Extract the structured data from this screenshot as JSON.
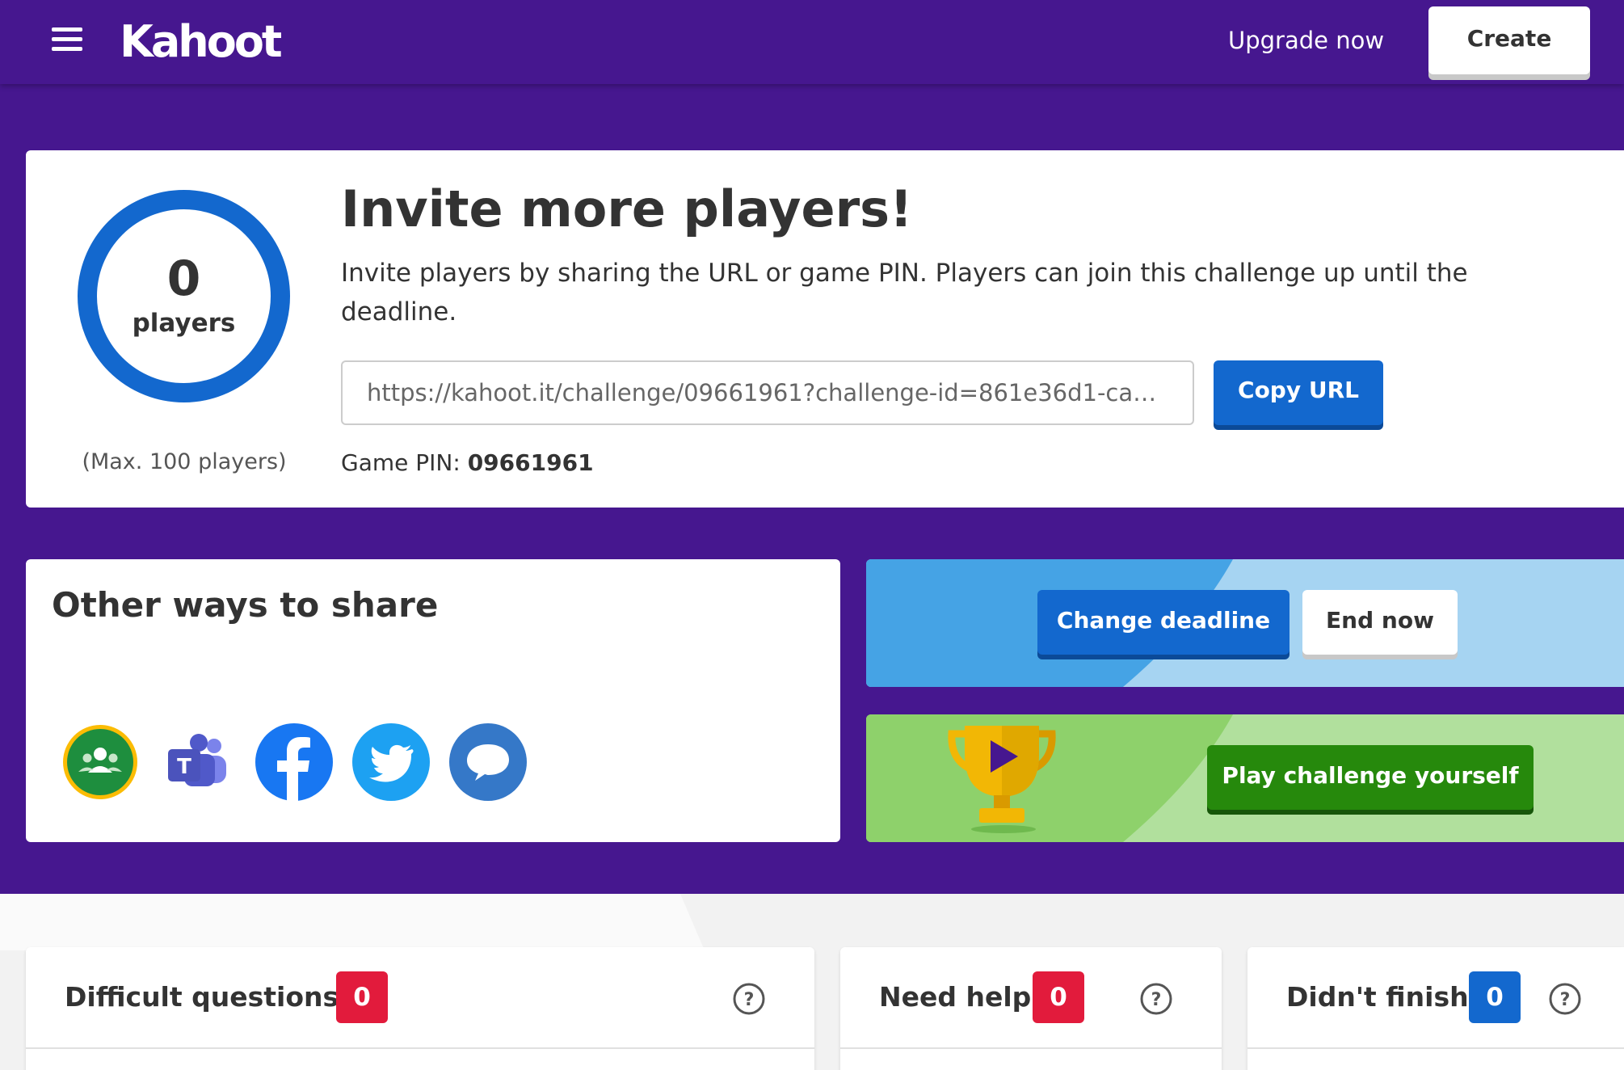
{
  "header": {
    "logo_text": "Kahoot!",
    "upgrade_label": "Upgrade now",
    "create_label": "Create"
  },
  "invite": {
    "player_count": "0",
    "player_label": "players",
    "max_players": "(Max. 100 players)",
    "title": "Invite more players!",
    "description": "Invite players by sharing the URL or game PIN. Players can join this challenge up until the deadline.",
    "url_value": "https://kahoot.it/challenge/09661961?challenge-id=861e36d1-cac9-4...",
    "copy_label": "Copy URL",
    "pin_label": "Game PIN: ",
    "pin_value": "09661961"
  },
  "share": {
    "title": "Other ways to share",
    "icons": [
      "google-classroom-icon",
      "microsoft-teams-icon",
      "facebook-icon",
      "twitter-icon",
      "remind-icon"
    ]
  },
  "deadline": {
    "change_label": "Change deadline",
    "end_label": "End now"
  },
  "play": {
    "label": "Play challenge yourself"
  },
  "stats": [
    {
      "label": "Difficult questions",
      "count": "0",
      "color": "#e21b3c"
    },
    {
      "label": "Need help",
      "count": "0",
      "color": "#e21b3c"
    },
    {
      "label": "Didn't finish",
      "count": "0",
      "color": "#1368ce"
    }
  ],
  "colors": {
    "brand_purple": "#46178f",
    "blue": "#1368ce",
    "green": "#26890c",
    "red": "#e21b3c"
  }
}
